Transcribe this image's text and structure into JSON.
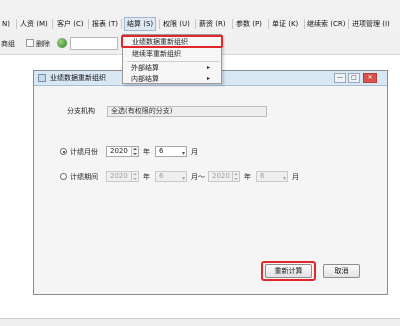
{
  "menubar": {
    "items": [
      {
        "label": "N)"
      },
      {
        "label": "人资 (M)"
      },
      {
        "label": "客户 (C)"
      },
      {
        "label": "报表 (T)"
      },
      {
        "label": "结算 (S)"
      },
      {
        "label": "权限 (U)"
      },
      {
        "label": "薪资 (R)"
      },
      {
        "label": "参数 (P)"
      },
      {
        "label": "单证 (K)"
      },
      {
        "label": "继续索 (CR)"
      },
      {
        "label": "进项管理 (I)"
      }
    ]
  },
  "toolbar": {
    "left_text": "商组",
    "delete_label": "删除"
  },
  "dropdown": {
    "items": [
      {
        "label": "业绩数据重新组织"
      },
      {
        "label": "继续率重新组织"
      },
      {
        "label": "外部结算"
      },
      {
        "label": "内部结算"
      }
    ],
    "submenu_arrow": "▸"
  },
  "dialog": {
    "title": "业绩数据重新组织",
    "branch_label": "分支机构",
    "branch_value": "全选(有权限的分支)",
    "month_mode_label": "计绩月份",
    "period_mode_label": "计绩期间",
    "year_value": "2020",
    "month_value": "6",
    "year_unit": "年",
    "month_unit": "月",
    "range_sep": "月～",
    "recalc_label": "重新计算",
    "cancel_label": "取消",
    "window_buttons": {
      "minimize": "—",
      "maximize": "□",
      "close": "✕"
    }
  },
  "colors": {
    "highlight": "#e2262c",
    "menubar_bg": "#f1f1f1",
    "dialog_title_bg": "#d9e6f3"
  }
}
